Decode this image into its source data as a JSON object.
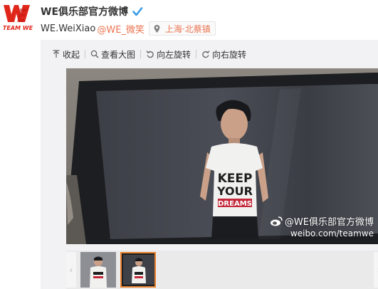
{
  "profile": {
    "nickname": "WE俱乐部官方微博",
    "logo_text": "TEAM WE",
    "verified_icon": "verified-badge-icon",
    "brand_color": "#e0261b"
  },
  "post": {
    "author": "WE.WeiXiao",
    "mention": "@WE_微笑",
    "location": "上海·北蔡镇",
    "accent_color": "#eb7350"
  },
  "toolbar": {
    "collapse": "收起",
    "view_large": "查看大图",
    "rotate_left": "向左旋转",
    "rotate_right": "向右旋转"
  },
  "photo": {
    "shirt_text_1": "KEEP",
    "shirt_text_2": "YOUR",
    "shirt_text_3": "DREAMS",
    "watermark_line1": "@WE俱乐部官方微博",
    "watermark_line2": "weibo.com/teamwe"
  },
  "thumbnails": {
    "selected_index": 1,
    "selected_color": "#e7812f",
    "prev_glyph": "‹",
    "next_glyph": "›"
  }
}
